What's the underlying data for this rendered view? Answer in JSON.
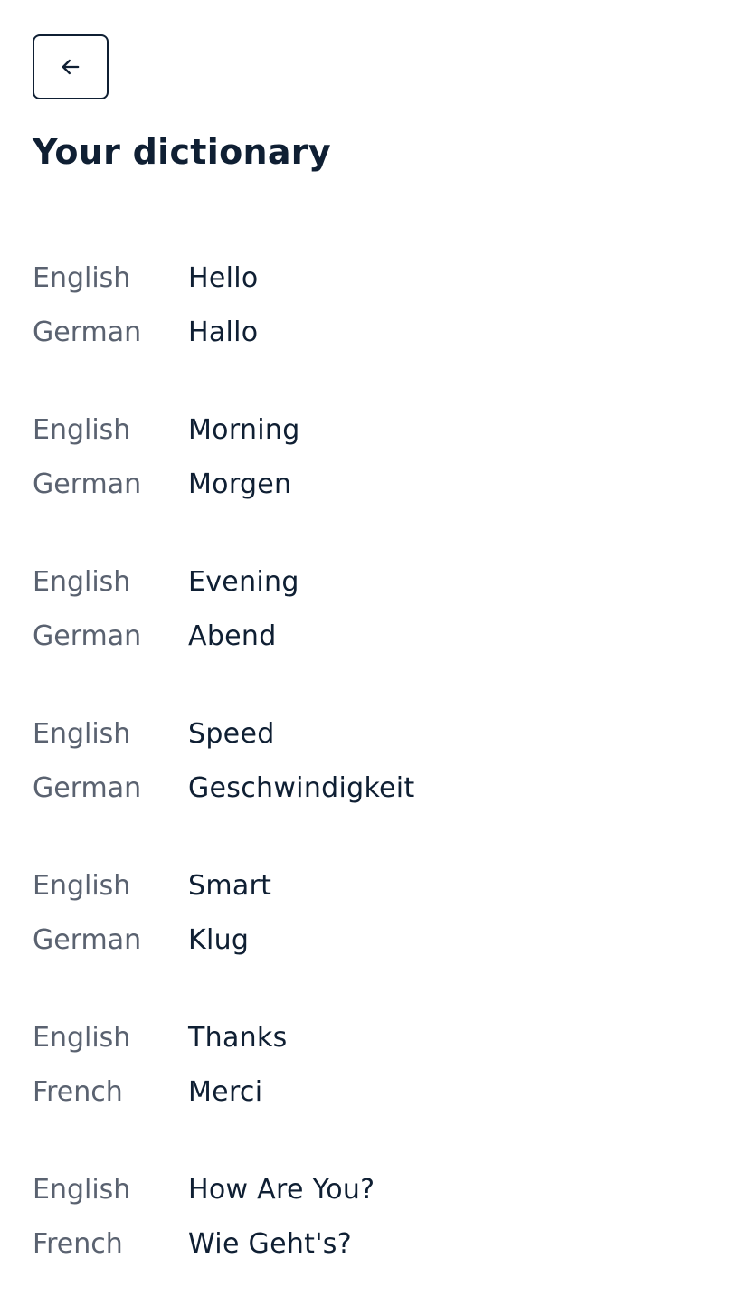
{
  "header": {
    "back_icon": "arrow-left-icon",
    "title": "Your dictionary"
  },
  "entries": [
    {
      "source_lang": "English",
      "source_word": "Hello",
      "target_lang": "German",
      "target_word": "Hallo"
    },
    {
      "source_lang": "English",
      "source_word": "Morning",
      "target_lang": "German",
      "target_word": "Morgen"
    },
    {
      "source_lang": "English",
      "source_word": "Evening",
      "target_lang": "German",
      "target_word": "Abend"
    },
    {
      "source_lang": "English",
      "source_word": "Speed",
      "target_lang": "German",
      "target_word": "Geschwindigkeit"
    },
    {
      "source_lang": "English",
      "source_word": "Smart",
      "target_lang": "German",
      "target_word": "Klug"
    },
    {
      "source_lang": "English",
      "source_word": "Thanks",
      "target_lang": "French",
      "target_word": "Merci"
    },
    {
      "source_lang": "English",
      "source_word": "How Are You?",
      "target_lang": "French",
      "target_word": "Wie Geht's?"
    }
  ],
  "colors": {
    "text_primary": "#0f1f33",
    "text_secondary": "#5a6270",
    "background": "#ffffff"
  }
}
